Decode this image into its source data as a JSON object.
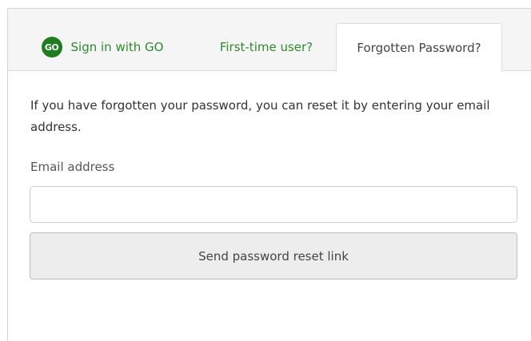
{
  "tabs": {
    "sign_in_go": {
      "logo_text": "GO",
      "label": "Sign in with GO"
    },
    "first_time": {
      "label": "First-time user?"
    },
    "forgotten": {
      "label": "Forgotten Password?"
    }
  },
  "active_tab": "forgotten",
  "forgot_form": {
    "description": "If you have forgotten your password, you can reset it by entering your email address.",
    "email_label": "Email address",
    "email_value": "",
    "email_placeholder": "",
    "submit_label": "Send password reset link"
  },
  "colors": {
    "brand_green": "#1e7d1e",
    "link_green": "#2f8a2f",
    "button_bg": "#ededed"
  }
}
